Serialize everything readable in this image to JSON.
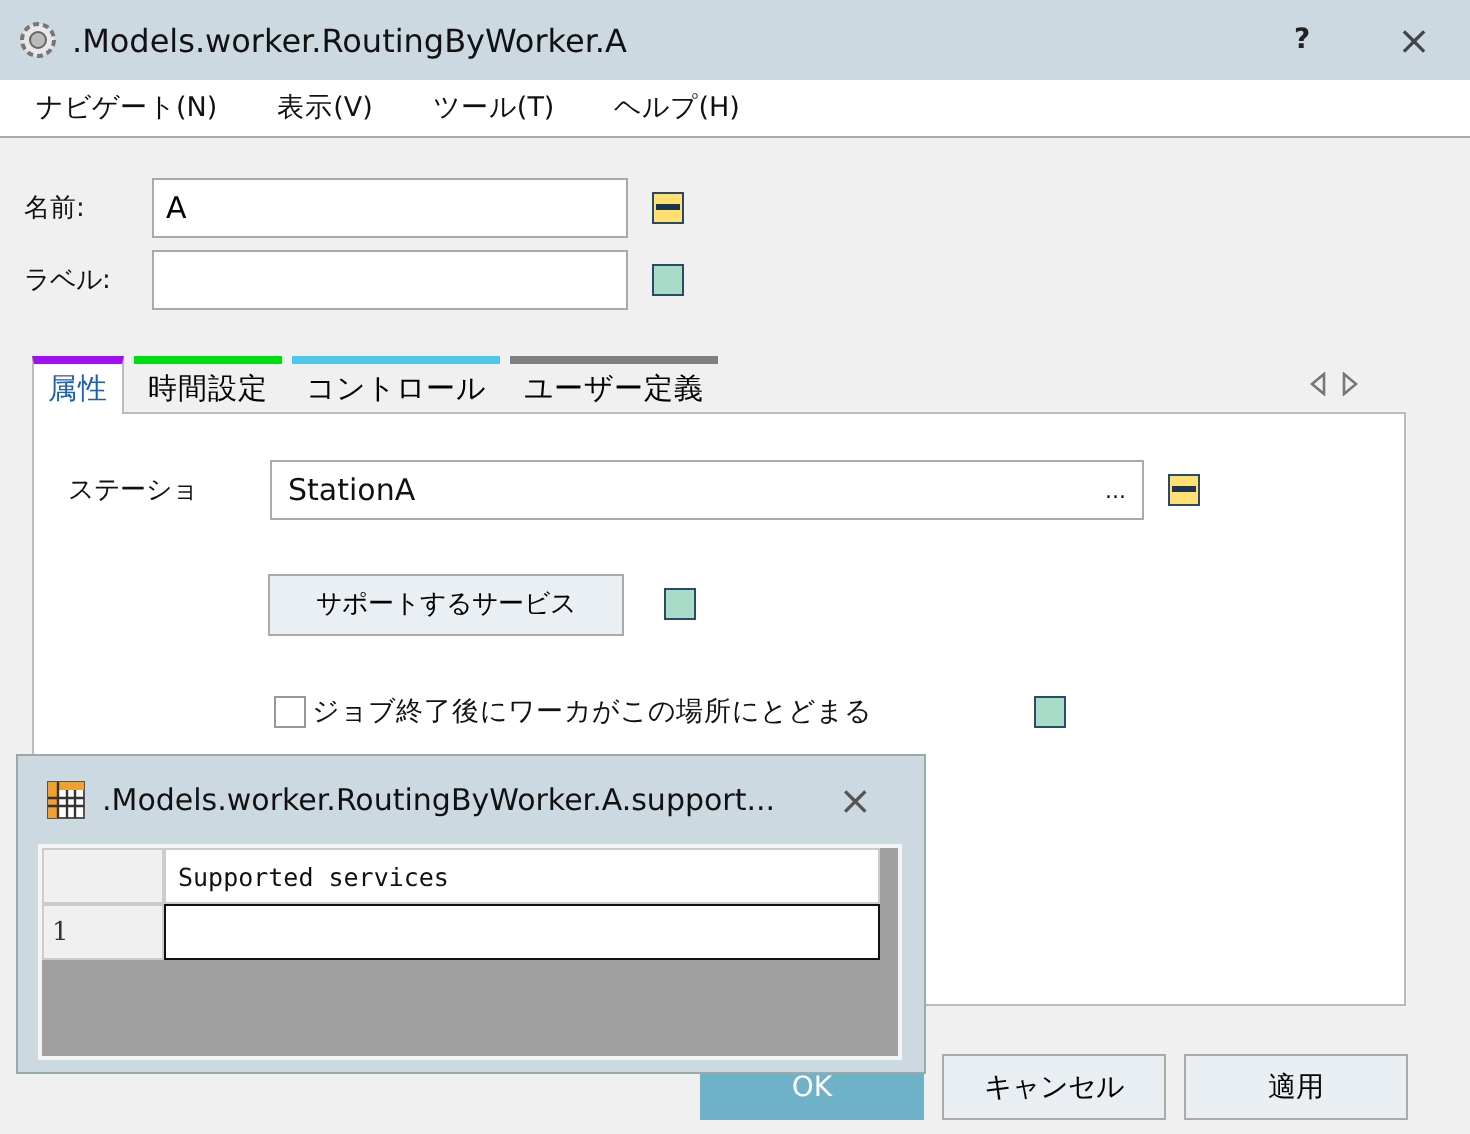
{
  "window": {
    "title": ".Models.worker.RoutingByWorker.A",
    "help": "?",
    "close": "×"
  },
  "menu": [
    "ナビゲート(N)",
    "表示(V)",
    "ツール(T)",
    "ヘルプ(H)"
  ],
  "fields": [
    {
      "label": "名前:",
      "value": "A",
      "dynamic": true
    },
    {
      "label": "ラベル:",
      "dynamic": false
    }
  ],
  "tabs": [
    {
      "label": "属性",
      "selected": true,
      "color": "#a010f0"
    },
    {
      "label": "時間設定",
      "selected": false,
      "color": "#00e010"
    },
    {
      "label": "コントロール",
      "selected": false,
      "color": "#50c8ec"
    },
    {
      "label": "ユーザー定義",
      "selected": false,
      "color": "#808080"
    }
  ],
  "panel": {
    "station": {
      "label": "ステーショ",
      "value": "StationA",
      "browse": "...",
      "dynamic": true
    },
    "services_button": {
      "label": "サポートするサービス",
      "dynamic": false
    },
    "stay_checkbox": {
      "label": "ジョブ終了後にワーカがこの場所にとどまる",
      "checked": false,
      "dynamic": false
    }
  },
  "buttons": [
    {
      "label": "OK",
      "kind": "primary"
    },
    {
      "label": "キャンセル",
      "kind": "normal"
    },
    {
      "label": "適用",
      "kind": "normal"
    }
  ],
  "popup": {
    "title": ".Models.worker.RoutingByWorker.A.support...",
    "close": "×",
    "columns": [
      "Supported services"
    ],
    "rows": [
      {
        "number": "1"
      }
    ]
  }
}
